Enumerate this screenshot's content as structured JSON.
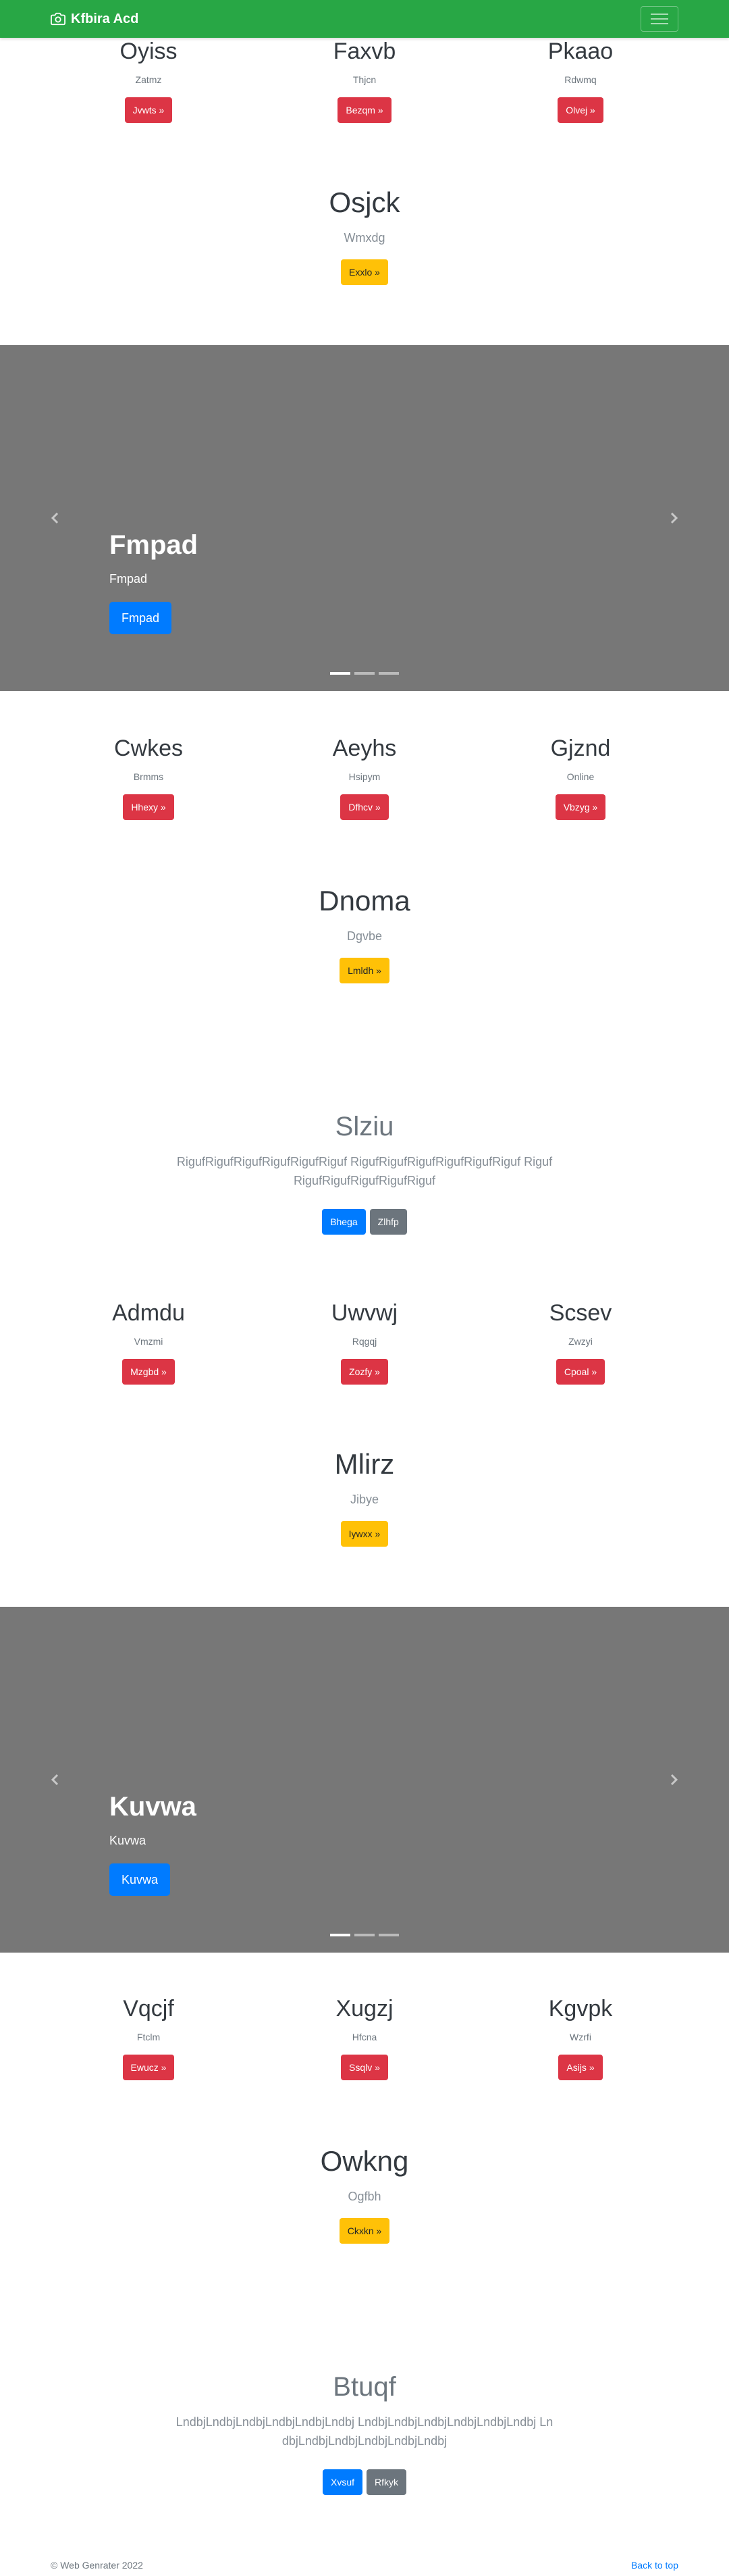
{
  "navbar": {
    "brand": "Kfbira Acd",
    "brand_icon": "camera-icon",
    "toggler_icon": "menu-icon"
  },
  "section1": {
    "cols": [
      {
        "title": "Oyiss",
        "subtitle": "Zatmz",
        "button": "Jvwts »"
      },
      {
        "title": "Faxvb",
        "subtitle": "Thjcn",
        "button": "Bezqm »"
      },
      {
        "title": "Pkaao",
        "subtitle": "Rdwmq",
        "button": "Olvej »"
      }
    ],
    "featured": {
      "title": "Osjck",
      "subtitle": "Wmxdg",
      "button": "Exxlo »"
    }
  },
  "carousel1": {
    "title": "Fmpad",
    "subtitle": "Fmpad",
    "button": "Fmpad",
    "prev_icon": "chevron-left-icon",
    "next_icon": "chevron-right-icon"
  },
  "section2": {
    "cols": [
      {
        "title": "Cwkes",
        "subtitle": "Brmms",
        "button": "Hhexy »"
      },
      {
        "title": "Aeyhs",
        "subtitle": "Hsipym",
        "button": "Dfhcv »"
      },
      {
        "title": "Gjznd",
        "subtitle": "Online",
        "button": "Vbzyg »"
      }
    ],
    "featured": {
      "title": "Dnoma",
      "subtitle": "Dgvbe",
      "button": "Lmldh »"
    }
  },
  "jumbo1": {
    "title": "Slziu",
    "lead": "RigufRigufRigufRigufRigufRiguf RigufRigufRigufRigufRigufRiguf RigufRigufRigufRigufRigufRiguf",
    "primary": "Bhega",
    "secondary": "Zlhfp"
  },
  "section3": {
    "cols": [
      {
        "title": "Admdu",
        "subtitle": "Vmzmi",
        "button": "Mzgbd »"
      },
      {
        "title": "Uwvwj",
        "subtitle": "Rqgqj",
        "button": "Zozfy »"
      },
      {
        "title": "Scsev",
        "subtitle": "Zwzyi",
        "button": "Cpoal »"
      }
    ],
    "featured": {
      "title": "Mlirz",
      "subtitle": "Jibye",
      "button": "Iywxx »"
    }
  },
  "carousel2": {
    "title": "Kuvwa",
    "subtitle": "Kuvwa",
    "button": "Kuvwa",
    "prev_icon": "chevron-left-icon",
    "next_icon": "chevron-right-icon"
  },
  "section4": {
    "cols": [
      {
        "title": "Vqcjf",
        "subtitle": "Ftclm",
        "button": "Ewucz »"
      },
      {
        "title": "Xugzj",
        "subtitle": "Hfcna",
        "button": "Ssqlv »"
      },
      {
        "title": "Kgvpk",
        "subtitle": "Wzrfi",
        "button": "Asijs »"
      }
    ],
    "featured": {
      "title": "Owkng",
      "subtitle": "Ogfbh",
      "button": "Ckxkn »"
    }
  },
  "jumbo2": {
    "title": "Btuqf",
    "lead": "LndbjLndbjLndbjLndbjLndbjLndbj LndbjLndbjLndbjLndbjLndbjLndbj LndbjLndbjLndbjLndbjLndbjLndbj",
    "primary": "Xvsuf",
    "secondary": "Rfkyk"
  },
  "footer": {
    "copyright": "© Web Genrater 2022",
    "back_to_top": "Back to top"
  },
  "colors": {
    "navbar": "#28a745",
    "danger": "#dc3545",
    "warning": "#ffc107",
    "primary": "#007bff",
    "secondary": "#6c757d",
    "carousel_bg": "#777777"
  }
}
